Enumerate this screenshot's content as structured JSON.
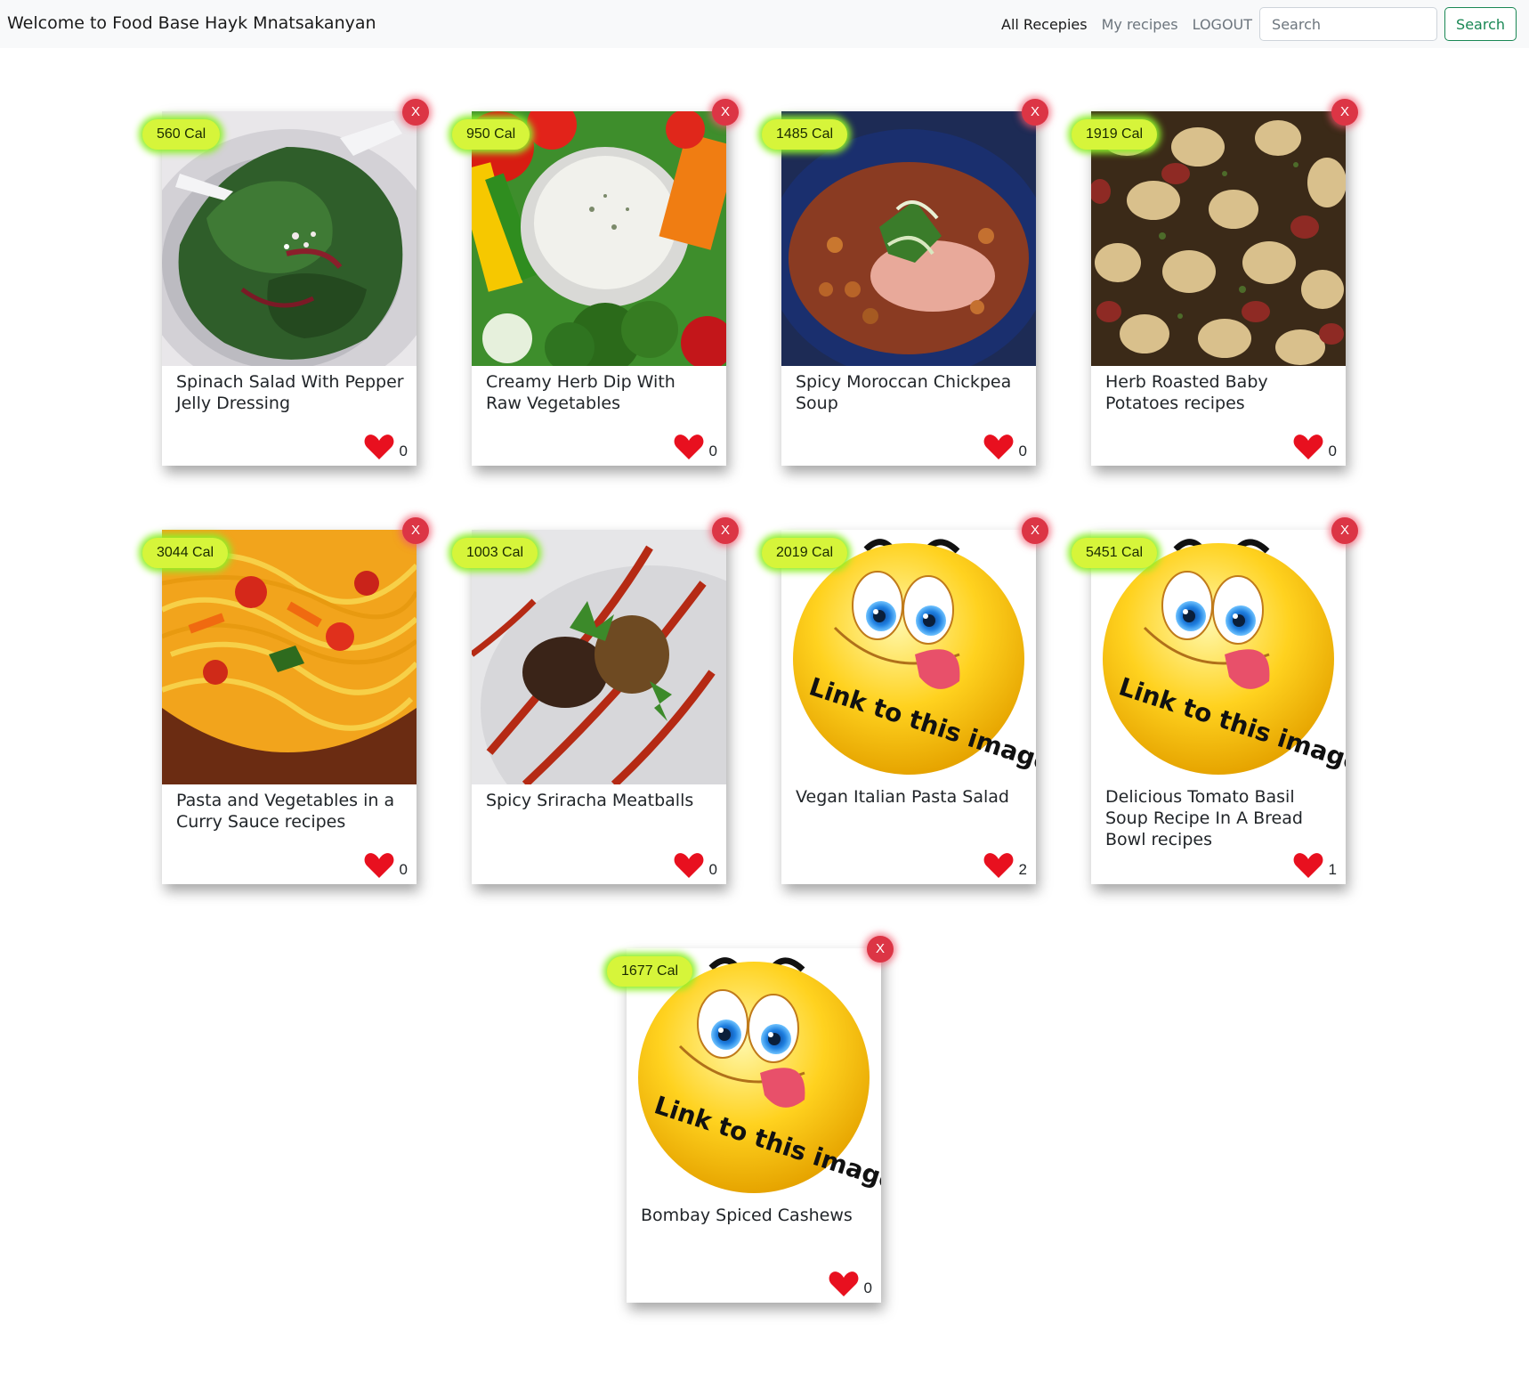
{
  "navbar": {
    "brand": "Welcome to Food Base Hayk Mnatsakanyan",
    "links": [
      "All Recepies",
      "My recipes",
      "LOGOUT"
    ],
    "search_placeholder": "Search",
    "search_button": "Search"
  },
  "close_label": "X",
  "expired_text": "Link to this image has EXPIRED!",
  "recipes": [
    {
      "calories": "560 Cal",
      "title": "Spinach Salad With Pepper Jelly Dressing",
      "likes": "0",
      "image": "spinach-salad"
    },
    {
      "calories": "950 Cal",
      "title": "Creamy Herb Dip With Raw Vegetables",
      "likes": "0",
      "image": "herb-dip"
    },
    {
      "calories": "1485 Cal",
      "title": "Spicy Moroccan Chickpea Soup",
      "likes": "0",
      "image": "chickpea-soup"
    },
    {
      "calories": "1919 Cal",
      "title": "Herb Roasted Baby Potatoes recipes",
      "likes": "0",
      "image": "roasted-potatoes"
    },
    {
      "calories": "3044 Cal",
      "title": "Pasta and Vegetables in a Curry Sauce recipes",
      "likes": "0",
      "image": "curry-pasta"
    },
    {
      "calories": "1003 Cal",
      "title": "Spicy Sriracha Meatballs",
      "likes": "0",
      "image": "meatballs"
    },
    {
      "calories": "2019 Cal",
      "title": "Vegan Italian Pasta Salad",
      "likes": "2",
      "image": "expired-smiley"
    },
    {
      "calories": "5451 Cal",
      "title": "Delicious Tomato Basil Soup Recipe In A Bread Bowl recipes",
      "likes": "1",
      "image": "expired-smiley"
    },
    {
      "calories": "1677 Cal",
      "title": "Bombay Spiced Cashews",
      "likes": "0",
      "image": "expired-smiley"
    }
  ]
}
